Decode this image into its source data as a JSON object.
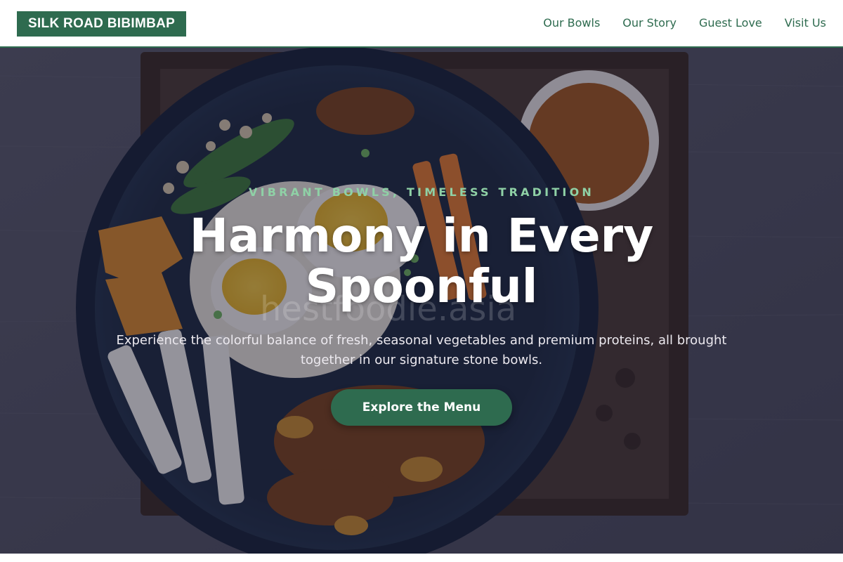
{
  "header": {
    "logo_text": "SILK ROAD BIBIMBAP",
    "nav": [
      {
        "label": "Our Bowls"
      },
      {
        "label": "Our Story"
      },
      {
        "label": "Guest Love"
      },
      {
        "label": "Visit Us"
      }
    ]
  },
  "hero": {
    "eyebrow": "VIBRANT BOWLS, TIMELESS TRADITION",
    "headline": "Harmony in Every Spoonful",
    "subtext": "Experience the colorful balance of fresh, seasonal vegetables and premium proteins, all brought together in our signature stone bowls.",
    "cta_label": "Explore the Menu",
    "watermark": "hestfoodie.asia"
  },
  "colors": {
    "brand_green": "#2e6b4f",
    "eyebrow_green": "#8fd1a6",
    "overlay": "#12142f"
  }
}
